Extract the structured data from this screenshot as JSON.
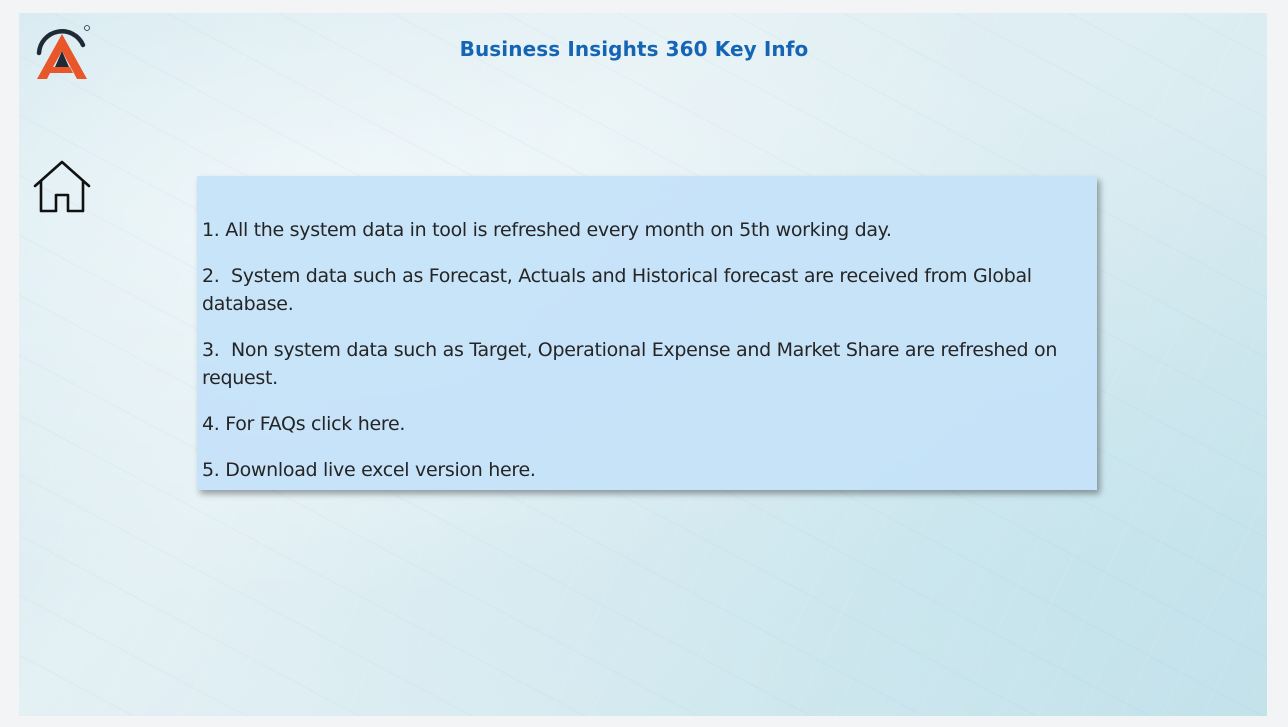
{
  "page": {
    "title": "Business Insights 360 Key Info",
    "title_color": "#1565b5"
  },
  "logo": {
    "icon": "brand-a-logo-icon",
    "colors": [
      "#e8562a",
      "#1f2a36"
    ]
  },
  "nav": {
    "home_icon": "home-icon"
  },
  "info": {
    "background": "#c4e2f8",
    "items": [
      "1. All the system data in tool is refreshed every month on 5th working day.",
      "2.  System data such as Forecast, Actuals and Historical forecast are received from Global database.",
      "3.  Non system data such as Target, Operational Expense and Market Share are refreshed on request.",
      "4. For FAQs click here.",
      "5. Download live excel version here."
    ]
  }
}
